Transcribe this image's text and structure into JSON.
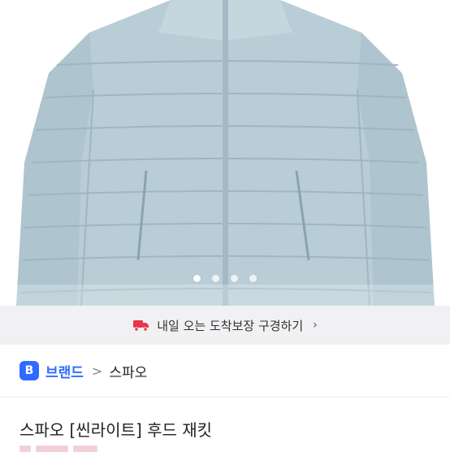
{
  "product_image": {
    "description_icon": "jacket-photo",
    "colors": {
      "jacket": "#b9cdd6",
      "jacket_shadow": "#9fb6c2",
      "jacket_light": "#cfdde4"
    },
    "carousel_total": 4,
    "carousel_active": 1,
    "expand_icon": "expand-icon"
  },
  "delivery_banner": {
    "icon": "truck-icon",
    "icon_color": "#e8344e",
    "text": "내일 오는 도착보장 구경하기",
    "chevron": "›"
  },
  "breadcrumb": {
    "badge_letter": "B",
    "brand_label": "브랜드",
    "separator": ">",
    "brand_name": "스파오",
    "accent": "#2f6bff"
  },
  "product": {
    "title": "스파오 [씬라이트] 후드 재킷"
  }
}
